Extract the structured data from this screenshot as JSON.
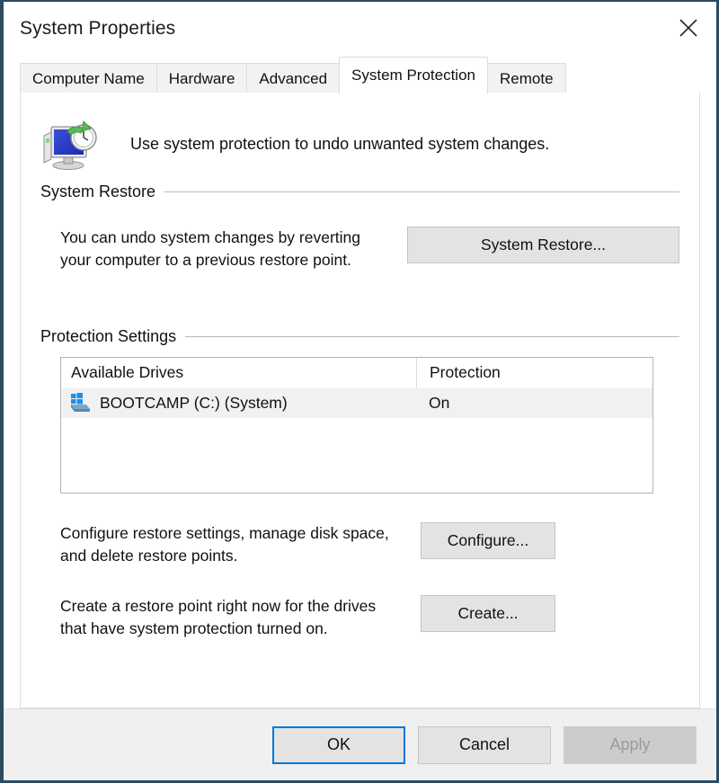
{
  "window": {
    "title": "System Properties",
    "close_icon": "close-icon",
    "border_color": "#2b4b63"
  },
  "tabs": [
    {
      "label": "Computer Name",
      "active": false
    },
    {
      "label": "Hardware",
      "active": false
    },
    {
      "label": "Advanced",
      "active": false
    },
    {
      "label": "System Protection",
      "active": true
    },
    {
      "label": "Remote",
      "active": false
    }
  ],
  "panel": {
    "header": {
      "icon": "system-protection-icon",
      "text": "Use system protection to undo unwanted system changes."
    },
    "system_restore": {
      "group_label": "System Restore",
      "description": "You can undo system changes by reverting your computer to a previous restore point.",
      "description_line1": "You can undo system changes by reverting",
      "description_line2": "your computer to a previous restore point.",
      "button_label": "System Restore..."
    },
    "protection_settings": {
      "group_label": "Protection Settings",
      "columns": [
        "Available Drives",
        "Protection"
      ],
      "rows": [
        {
          "icon": "windows-drive-icon",
          "drive": "BOOTCAMP (C:) (System)",
          "protection": "On",
          "selected": true
        }
      ],
      "configure": {
        "description_line1": "Configure restore settings, manage disk space,",
        "description_line2": "and delete restore points.",
        "button_label": "Configure..."
      },
      "create": {
        "description_line1": "Create a restore point right now for the drives",
        "description_line2": "that have system protection turned on.",
        "button_label": "Create..."
      }
    }
  },
  "footer": {
    "ok_label": "OK",
    "cancel_label": "Cancel",
    "apply_label": "Apply",
    "accent_color": "#0078d7"
  }
}
